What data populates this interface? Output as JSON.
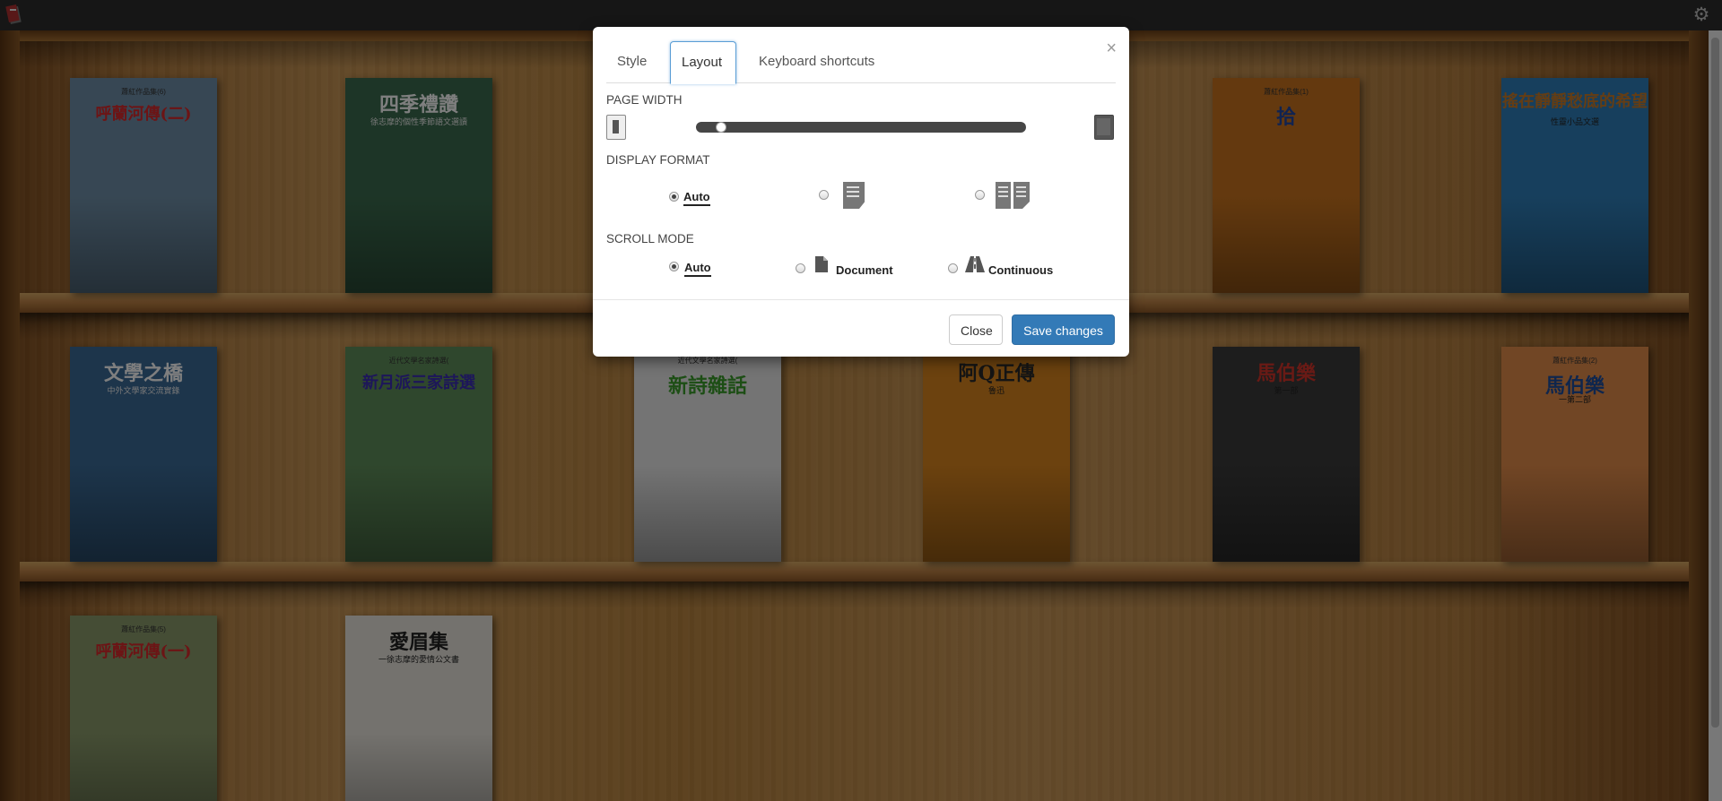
{
  "topbar": {
    "logo_icon": "app-logo-icon",
    "settings_icon": "gear-icon"
  },
  "books": [
    {
      "row": 0,
      "col": 0,
      "small": "蕭紅作品集(6)",
      "title": "呼蘭河傳(二)",
      "sub": "",
      "bg": "#6f8fa8",
      "title_color": "#d8282a"
    },
    {
      "row": 0,
      "col": 1,
      "small": "",
      "title": "四季禮讚",
      "sub": "徐志摩的個性季節語文選讀",
      "bg": "#3b6b4e",
      "title_color": "#ffffff"
    },
    {
      "row": 0,
      "col": 4,
      "small": "蕭紅作品集(1)",
      "title": "拾",
      "sub": "",
      "bg": "#c8731e",
      "title_color": "#2247a0"
    },
    {
      "row": 0,
      "col": 5,
      "small": "",
      "title": "搖在靜靜愁底的希望",
      "sub": "性靈小品文選",
      "bg": "#2f7fba",
      "title_color": "#c87a28"
    },
    {
      "row": 1,
      "col": 0,
      "small": "",
      "title": "文學之橋",
      "sub": "中外文學家交流實錄",
      "bg": "#3a6a96",
      "title_color": "#ffffff"
    },
    {
      "row": 1,
      "col": 1,
      "small": "近代文學名家詩選(",
      ")": "",
      "title": "新月派三家詩選",
      "sub": "",
      "bg": "#5f8e5a",
      "title_color": "#3a2db5"
    },
    {
      "row": 1,
      "col": 2,
      "small": "近代文學名家詩選(",
      "title": "新詩雜話",
      "sub": "",
      "bg": "#e9e9e9",
      "title_color": "#3a9d2a"
    },
    {
      "row": 1,
      "col": 3,
      "small": "",
      "title": "阿Q正傳",
      "sub": "魯迅",
      "bg": "#d8841e",
      "title_color": "#2a2a2a"
    },
    {
      "row": 1,
      "col": 4,
      "small": "",
      "title": "馬伯樂",
      "sub": "第一部",
      "bg": "#3a3a3a",
      "title_color": "#d3342a"
    },
    {
      "row": 1,
      "col": 5,
      "small": "蕭紅作品集(2)",
      "title": "馬伯樂",
      "sub": "一第二部",
      "bg": "#e38c4a",
      "title_color": "#1f4d9b"
    },
    {
      "row": 2,
      "col": 0,
      "small": "蕭紅作品集(5)",
      "title": "呼蘭河傳(一)",
      "sub": "",
      "bg": "#8a9a6a",
      "title_color": "#d8282a"
    },
    {
      "row": 2,
      "col": 1,
      "small": "",
      "title": "愛眉集",
      "sub": "一徐志摩的愛情公文書",
      "bg": "#e8e4dc",
      "title_color": "#222222"
    }
  ],
  "modal": {
    "close_symbol": "×",
    "tabs": [
      {
        "label": "Style"
      },
      {
        "label": "Layout"
      },
      {
        "label": "Keyboard shortcuts"
      }
    ],
    "page_width_label": "PAGE WIDTH",
    "page_width_value": 0.04,
    "display_format_label": "DISPLAY FORMAT",
    "display_format_options": [
      {
        "label": "Auto",
        "selected": true
      },
      {
        "label": "",
        "icon": "single-page-icon",
        "selected": false
      },
      {
        "label": "",
        "icon": "two-page-icon",
        "selected": false
      }
    ],
    "scroll_mode_label": "SCROLL MODE",
    "scroll_mode_options": [
      {
        "label": "Auto",
        "selected": true
      },
      {
        "label": "Document",
        "icon": "document-icon",
        "selected": false
      },
      {
        "label": "Continuous",
        "icon": "road-icon",
        "selected": false
      }
    ],
    "close_button": "Close",
    "save_button": "Save changes"
  }
}
